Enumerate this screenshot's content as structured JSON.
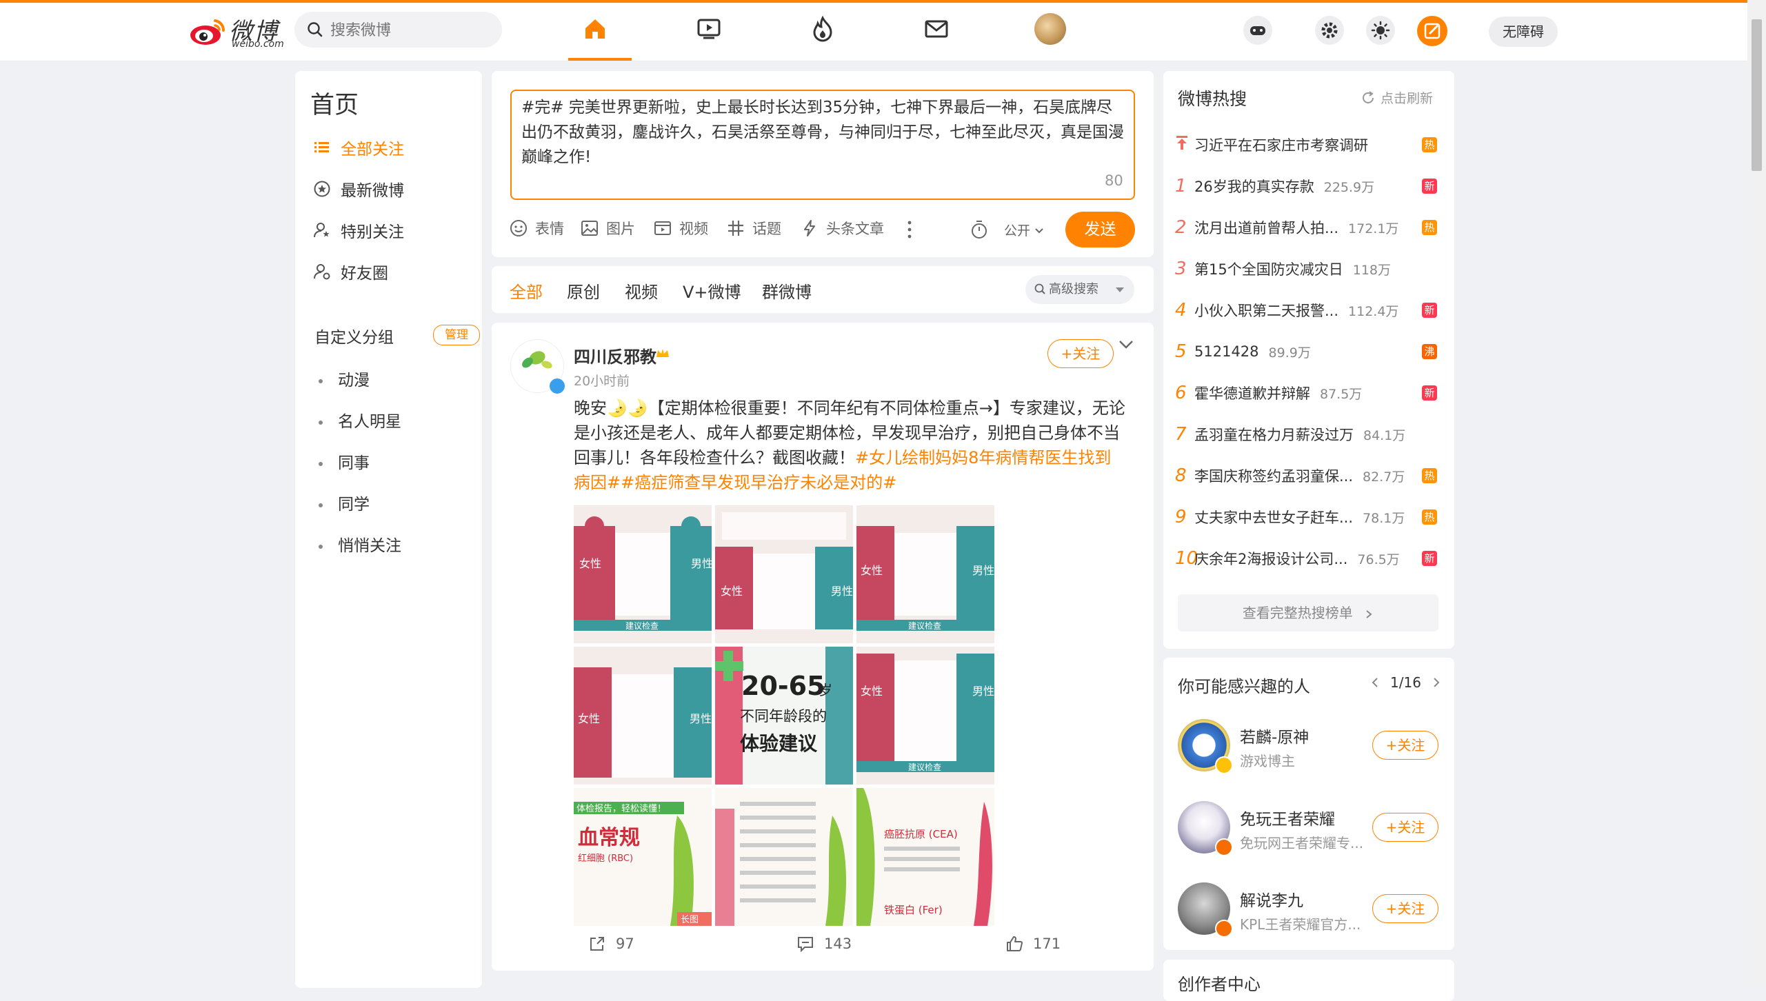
{
  "header": {
    "logo_cn": "微博",
    "logo_en": "weibo.com",
    "search_placeholder": "搜索微博",
    "accessibility_label": "无障碍",
    "accent_color": "#ff8200",
    "nav_icons": [
      "home-icon",
      "video-icon",
      "hot-icon",
      "message-icon"
    ]
  },
  "left_nav": {
    "title": "首页",
    "items": [
      {
        "label": "全部关注",
        "icon": "list-icon",
        "active": true
      },
      {
        "label": "最新微博",
        "icon": "clock-star-icon"
      },
      {
        "label": "特别关注",
        "icon": "user-star-icon"
      },
      {
        "label": "好友圈",
        "icon": "user-circle-icon"
      }
    ],
    "group_title": "自定义分组",
    "manage_label": "管理",
    "groups": [
      "动漫",
      "名人明星",
      "同事",
      "同学",
      "悄悄关注"
    ]
  },
  "compose": {
    "text": "#完# 完美世界更新啦，史上最长时长达到35分钟，七神下界最后一神，石昊底牌尽出仍不敌黄羽，鏖战许久，石昊活祭至尊骨，与神同归于尽，七神至此尽灭，真是国漫巅峰之作!",
    "count": "80",
    "tools": [
      "表情",
      "图片",
      "视频",
      "话题",
      "头条文章"
    ],
    "visibility": "公开",
    "send_label": "发送"
  },
  "feed_tabs": {
    "tabs": [
      "全部",
      "原创",
      "视频",
      "V+微博",
      "群微博"
    ],
    "advanced_search": "高级搜索"
  },
  "post": {
    "author": "四川反邪教",
    "time": "20小时前",
    "follow_label": "+关注",
    "text_plain": "晚安🌛🌛【定期体检很重要！不同年纪有不同体检重点→】专家建议，无论是小孩还是老人、成年人都要定期体检，早发现早治疗，别把自己身体不当回事儿！各年段检查什么？截图收藏！",
    "text_tag": "#女儿绘制妈妈8年病情帮医生找到病因##癌症筛查早发现早治疗未必是对的#",
    "center_image": {
      "age": "20-65",
      "unit": "岁",
      "line1": "不同年龄段的",
      "line2": "体验建议"
    },
    "tile_labels": {
      "female": "女性",
      "male": "男性",
      "advice": "建议检查",
      "blood_title": "血常规",
      "blood_sub": "红细胞 (RBC)",
      "long_image": "长图",
      "cea": "癌胚抗原 (CEA)",
      "ferritin": "铁蛋白 (Fer)",
      "report": "体检报告，轻松读懂！"
    },
    "reposts": "97",
    "comments": "143",
    "likes": "171"
  },
  "hot_search": {
    "title": "微博热搜",
    "refresh_label": "点击刷新",
    "items": [
      {
        "rank": "",
        "title": "习近平在石家庄市考察调研",
        "count": "",
        "badge": "热",
        "badge_type": "hot",
        "pinned": true
      },
      {
        "rank": "1",
        "title": "26岁我的真实存款",
        "count": "225.9万",
        "badge": "新",
        "badge_type": "new"
      },
      {
        "rank": "2",
        "title": "沈月出道前曾帮人拍...",
        "count": "172.1万",
        "badge": "热",
        "badge_type": "hot"
      },
      {
        "rank": "3",
        "title": "第15个全国防灾减灾日",
        "count": "118万",
        "badge": "",
        "badge_type": ""
      },
      {
        "rank": "4",
        "title": "小伙入职第二天报警...",
        "count": "112.4万",
        "badge": "新",
        "badge_type": "new"
      },
      {
        "rank": "5",
        "title": "5121428",
        "count": "89.9万",
        "badge": "沸",
        "badge_type": "boil"
      },
      {
        "rank": "6",
        "title": "霍华德道歉并辩解",
        "count": "87.5万",
        "badge": "新",
        "badge_type": "new"
      },
      {
        "rank": "7",
        "title": "孟羽童在格力月薪没过万",
        "count": "84.1万",
        "badge": "",
        "badge_type": ""
      },
      {
        "rank": "8",
        "title": "李国庆称签约孟羽童保...",
        "count": "82.7万",
        "badge": "热",
        "badge_type": "hot"
      },
      {
        "rank": "9",
        "title": "丈夫家中去世女子赶车...",
        "count": "78.1万",
        "badge": "热",
        "badge_type": "hot"
      },
      {
        "rank": "10",
        "title": "庆余年2海报设计公司...",
        "count": "76.5万",
        "badge": "新",
        "badge_type": "new"
      }
    ],
    "more_label": "查看完整热搜榜单"
  },
  "suggestions": {
    "title": "你可能感兴趣的人",
    "page": "1/16",
    "follow_label": "+关注",
    "people": [
      {
        "name": "若麟-原神",
        "desc": "游戏博主",
        "badge_color": "#ffc107"
      },
      {
        "name": "免玩王者荣耀",
        "desc": "免玩网王者荣耀专...",
        "badge_color": "#f56c00"
      },
      {
        "name": "解说李九",
        "desc": "KPL王者荣耀官方...",
        "badge_color": "#f56c00"
      }
    ]
  },
  "creator_center": {
    "title": "创作者中心"
  }
}
